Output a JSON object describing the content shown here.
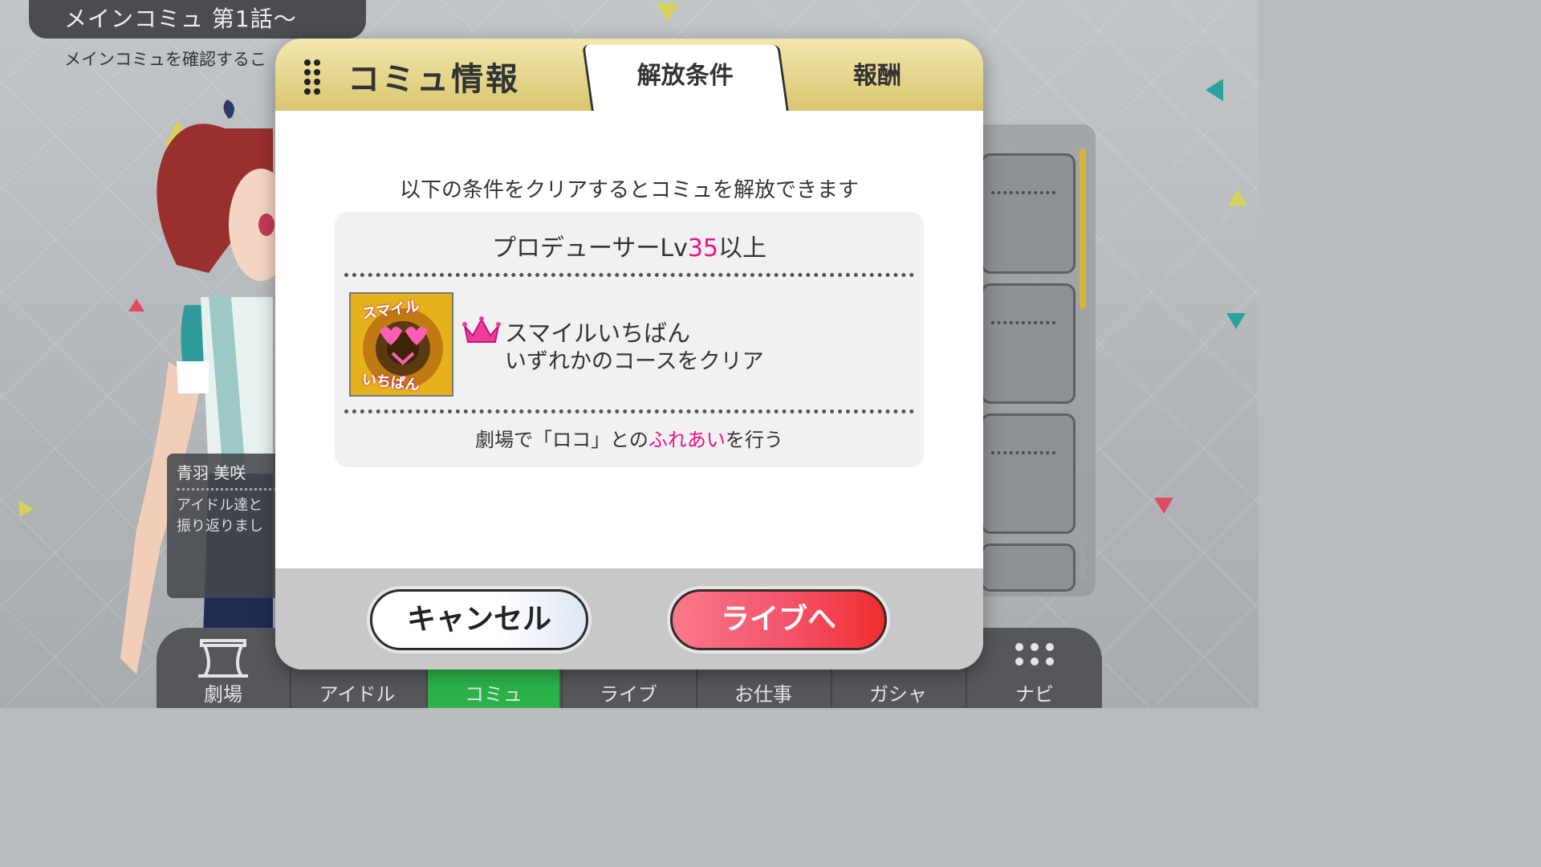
{
  "header": {
    "title": "メインコミュ 第1話～",
    "subtitle": "メインコミュを確認するこ"
  },
  "left_card": {
    "name": "青羽 美咲",
    "description": "アイドル達と\n振り返りまし"
  },
  "bottom_nav": {
    "items": [
      {
        "label": "劇場",
        "icon": "theater-icon"
      },
      {
        "label": "アイドル",
        "icon": "idol-icon"
      },
      {
        "label": "コミュ",
        "icon": "commu-icon",
        "active": true
      },
      {
        "label": "ライブ",
        "icon": "live-icon"
      },
      {
        "label": "お仕事",
        "icon": "work-icon"
      },
      {
        "label": "ガシャ",
        "icon": "gacha-icon"
      },
      {
        "label": "ナビ",
        "icon": "navi-icon"
      }
    ]
  },
  "modal": {
    "title": "コミュ情報",
    "tabs": {
      "conditions": "解放条件",
      "rewards": "報酬"
    },
    "instruction": "以下の条件をクリアするとコミュを解放できます",
    "requirement": {
      "prefix": "プロデューサーLv",
      "level": "35",
      "suffix": "以上"
    },
    "condition": {
      "medal_text_top": "スマイル",
      "medal_text_bottom": "いちばん",
      "name": "スマイルいちばん",
      "description": "いずれかのコースをクリア"
    },
    "extra": {
      "prefix": "劇場で「ロコ」との",
      "highlight": "ふれあい",
      "suffix": "を行う"
    },
    "buttons": {
      "cancel": "キャンセル",
      "live": "ライブへ"
    }
  },
  "colors": {
    "accent_pink": "#e9148c",
    "header_gold": "#d9c66f",
    "live_button": "#f4536a",
    "nav_active": "#2bb34a"
  }
}
